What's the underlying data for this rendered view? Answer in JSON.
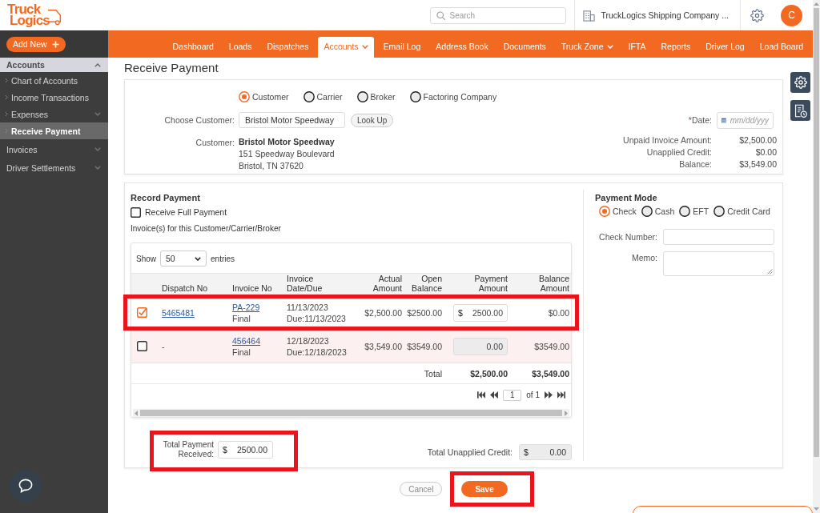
{
  "header": {
    "logo": [
      "Truck",
      "Logics"
    ],
    "search": {
      "placeholder": "Search"
    },
    "company": "TruckLogics Shipping Company ...",
    "avatar": "C"
  },
  "nav": {
    "add_new": "Add New",
    "items": [
      {
        "label": "Dashboard",
        "selected": false,
        "dropdown": false
      },
      {
        "label": "Loads",
        "selected": false,
        "dropdown": false
      },
      {
        "label": "Dispatches",
        "selected": false,
        "dropdown": false
      },
      {
        "label": "Accounts",
        "selected": true,
        "dropdown": true
      },
      {
        "label": "Email Log",
        "selected": false,
        "dropdown": false
      },
      {
        "label": "Address Book",
        "selected": false,
        "dropdown": false
      },
      {
        "label": "Documents",
        "selected": false,
        "dropdown": false
      },
      {
        "label": "Truck Zone",
        "selected": false,
        "dropdown": true
      },
      {
        "label": "IFTA",
        "selected": false,
        "dropdown": false
      },
      {
        "label": "Reports",
        "selected": false,
        "dropdown": false
      },
      {
        "label": "Driver Log",
        "selected": false,
        "dropdown": false
      },
      {
        "label": "Load Board",
        "selected": false,
        "dropdown": false
      }
    ]
  },
  "sidebar": {
    "items": [
      {
        "label": "Accounts",
        "expanded": true,
        "children": [
          {
            "label": "Chart of Accounts",
            "selected": false,
            "submenu": false
          },
          {
            "label": "Income Transactions",
            "selected": false,
            "submenu": false
          },
          {
            "label": "Expenses",
            "selected": false,
            "submenu": true
          },
          {
            "label": "Receive Payment",
            "selected": true,
            "submenu": false
          }
        ]
      },
      {
        "label": "Invoices",
        "expanded": false
      },
      {
        "label": "Driver Settlements",
        "expanded": false
      }
    ]
  },
  "page": {
    "title": "Receive Payment"
  },
  "customer": {
    "party_types": [
      {
        "label": "Customer",
        "selected": true
      },
      {
        "label": "Carrier",
        "selected": false
      },
      {
        "label": "Broker",
        "selected": false
      },
      {
        "label": "Factoring Company",
        "selected": false
      }
    ],
    "choose": {
      "label": "Choose Customer:",
      "value": "Bristol Motor Speedway",
      "button": "Look Up"
    },
    "details": {
      "label": "Customer:",
      "name": "Bristol Motor Speedway",
      "lines": [
        "151 Speedway Boulevard",
        "Bristol, TN 37620"
      ]
    },
    "date": {
      "required_mark": "*",
      "label": "Date:",
      "placeholder": "mm/dd/yyy"
    },
    "summary": [
      {
        "label": "Unpaid Invoice Amount:",
        "value": "$2,500.00"
      },
      {
        "label": "Unapplied Credit:",
        "value": "$0.00"
      },
      {
        "label": "Balance:",
        "value": "$3,549.00"
      }
    ]
  },
  "record_payment": {
    "title": "Record Payment",
    "full_payment": {
      "label": "Receive Full Payment",
      "checked": false
    },
    "caption": "Invoice(s) for this Customer/Carrier/Broker",
    "table": {
      "show_label": "Show",
      "page_size": "50",
      "entries_label": "entries",
      "columns": [
        "Dispatch No",
        "Invoice No",
        "Invoice Date/Due",
        "Actual Amount",
        "Open Balance",
        "Payment Amount",
        "Balance Amount"
      ],
      "rows": [
        {
          "checked": true,
          "highlighted": true,
          "shaded": false,
          "dispatch_no": "5465481",
          "dispatch_link": true,
          "invoice_no": "PA-229",
          "invoice_status": "Final",
          "invoice_date": "11/13/2023",
          "due": "Due:11/13/2023",
          "actual_amount": "$2,500.00",
          "open_balance": "$2500.00",
          "payment_currency": "$",
          "payment_amount": "2500.00",
          "payment_disabled": false,
          "balance_amount": "$0.00"
        },
        {
          "checked": false,
          "highlighted": false,
          "shaded": true,
          "dispatch_no": "-",
          "dispatch_link": false,
          "invoice_no": "456464",
          "invoice_status": "Final",
          "invoice_date": "12/18/2023",
          "due": "Due:12/18/2023",
          "actual_amount": "$3,549.00",
          "open_balance": "$3549.00",
          "payment_amount": "0.00",
          "payment_disabled": true,
          "balance_amount": "$3549.00"
        }
      ],
      "totals": {
        "label": "Total",
        "payment_amount": "$2,500.00",
        "balance_amount": "$3,549.00"
      },
      "pager": {
        "page": "1",
        "of_label": "of 1"
      }
    },
    "total_payment": {
      "label": "Total Payment Received:",
      "currency": "$",
      "value": "2500.00",
      "highlighted": true
    },
    "unapplied_credit": {
      "label": "Total Unapplied Credit:",
      "currency": "$",
      "value": "0.00",
      "disabled": true
    }
  },
  "payment_mode": {
    "title": "Payment Mode",
    "options": [
      {
        "label": "Check",
        "selected": true
      },
      {
        "label": "Cash",
        "selected": false
      },
      {
        "label": "EFT",
        "selected": false
      },
      {
        "label": "Credit Card",
        "selected": false
      }
    ],
    "fields": [
      {
        "kind": "input",
        "label": "Check Number:"
      },
      {
        "kind": "textarea",
        "label": "Memo:"
      }
    ]
  },
  "actions": [
    {
      "label": "Cancel",
      "kind": "secondary",
      "highlighted": false
    },
    {
      "label": "Save",
      "kind": "primary",
      "highlighted": true
    }
  ]
}
